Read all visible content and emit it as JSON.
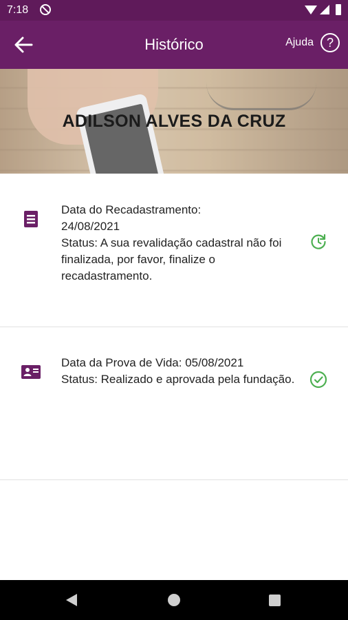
{
  "status_bar": {
    "time": "7:18",
    "icons": [
      "sync-disabled-icon",
      "wifi-icon",
      "signal-icon",
      "battery-icon"
    ]
  },
  "app_bar": {
    "title": "Histórico",
    "back_icon": "arrow-left-icon",
    "help_label": "Ajuda",
    "help_icon": "help-circle-icon",
    "help_icon_glyph": "?"
  },
  "hero": {
    "name": "ADILSON ALVES DA CRUZ"
  },
  "history": [
    {
      "icon": "document-list-icon",
      "line1": "Data do Recadastramento:",
      "line2": "24/08/2021",
      "status": "Status: A sua revalidação cadastral não foi finalizada, por favor, finalize o recadastramento.",
      "status_icon": "refresh-clock-icon"
    },
    {
      "icon": "id-card-icon",
      "line1": "Data da Prova de Vida: 05/08/2021",
      "status": "Status: Realizado e aprovada pela fundação.",
      "status_icon": "check-circle-icon"
    }
  ],
  "colors": {
    "primary": "#6a1f66",
    "status_bar": "#5f1a5a",
    "success": "#4caf50"
  },
  "nav_bar": {
    "icons": [
      "nav-back-icon",
      "nav-home-icon",
      "nav-recents-icon"
    ]
  }
}
